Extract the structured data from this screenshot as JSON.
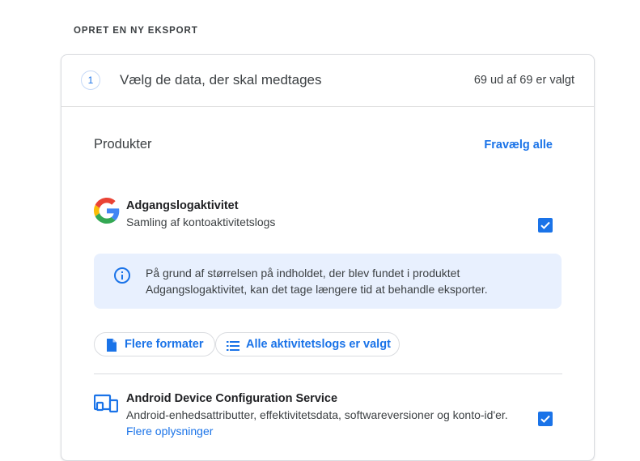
{
  "section_heading": "OPRET EN NY EKSPORT",
  "step": {
    "number": "1",
    "title": "Vælg de data, der skal medtages",
    "count_text": "69 ud af 69 er valgt"
  },
  "products_section": {
    "label": "Produkter",
    "deselect_all": "Fravælg alle"
  },
  "products": [
    {
      "name": "Adgangslogaktivitet",
      "description": "Samling af kontoaktivitetslogs",
      "icon": "google-g-icon",
      "checked": true,
      "info_message": "På grund af størrelsen på indholdet, der blev fundet i produktet Adgangslogaktivitet, kan det tage længere tid at behandle eksporter.",
      "options": {
        "formats_label": "Flere formater",
        "activity_logs_label": "Alle aktivitetslogs er valgt"
      }
    },
    {
      "name": "Android Device Configuration Service",
      "description": "Android-enhedsattributter, effektivitetsdata, softwareversioner og konto-id'er.",
      "icon": "devices-icon",
      "checked": true,
      "more_info": "Flere oplysninger"
    }
  ],
  "colors": {
    "accent": "#1a73e8",
    "info_bg": "#e8f0fe",
    "border": "#dadce0"
  }
}
